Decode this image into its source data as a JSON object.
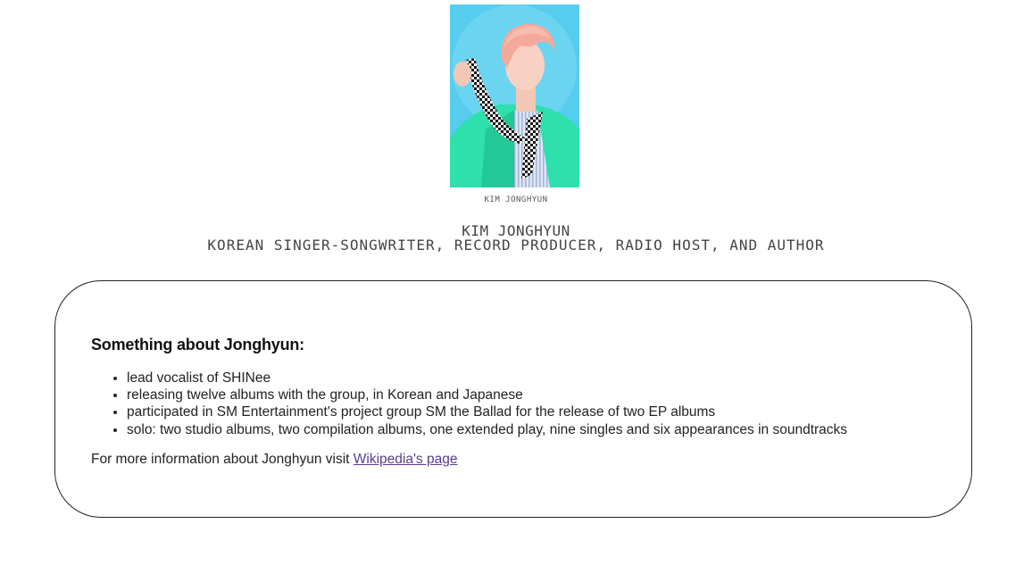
{
  "portrait": {
    "caption": "Kim Jonghyun"
  },
  "header": {
    "name": "Kim Jonghyun",
    "subtitle": "Korean singer-songwriter, record producer, radio host, and author"
  },
  "card": {
    "heading": "Something about Jonghyun:",
    "facts": [
      "lead vocalist of SHINee",
      "releasing twelve albums with the group, in Korean and Japanese",
      "participated in SM Entertainment's project group SM the Ballad for the release of two EP albums",
      "solo: two studio albums, two compilation albums, one extended play, nine singles and six appearances in soundtracks"
    ],
    "more_info_text": "For more information about Jonghyun visit ",
    "link_text": "Wikipedia's page"
  }
}
